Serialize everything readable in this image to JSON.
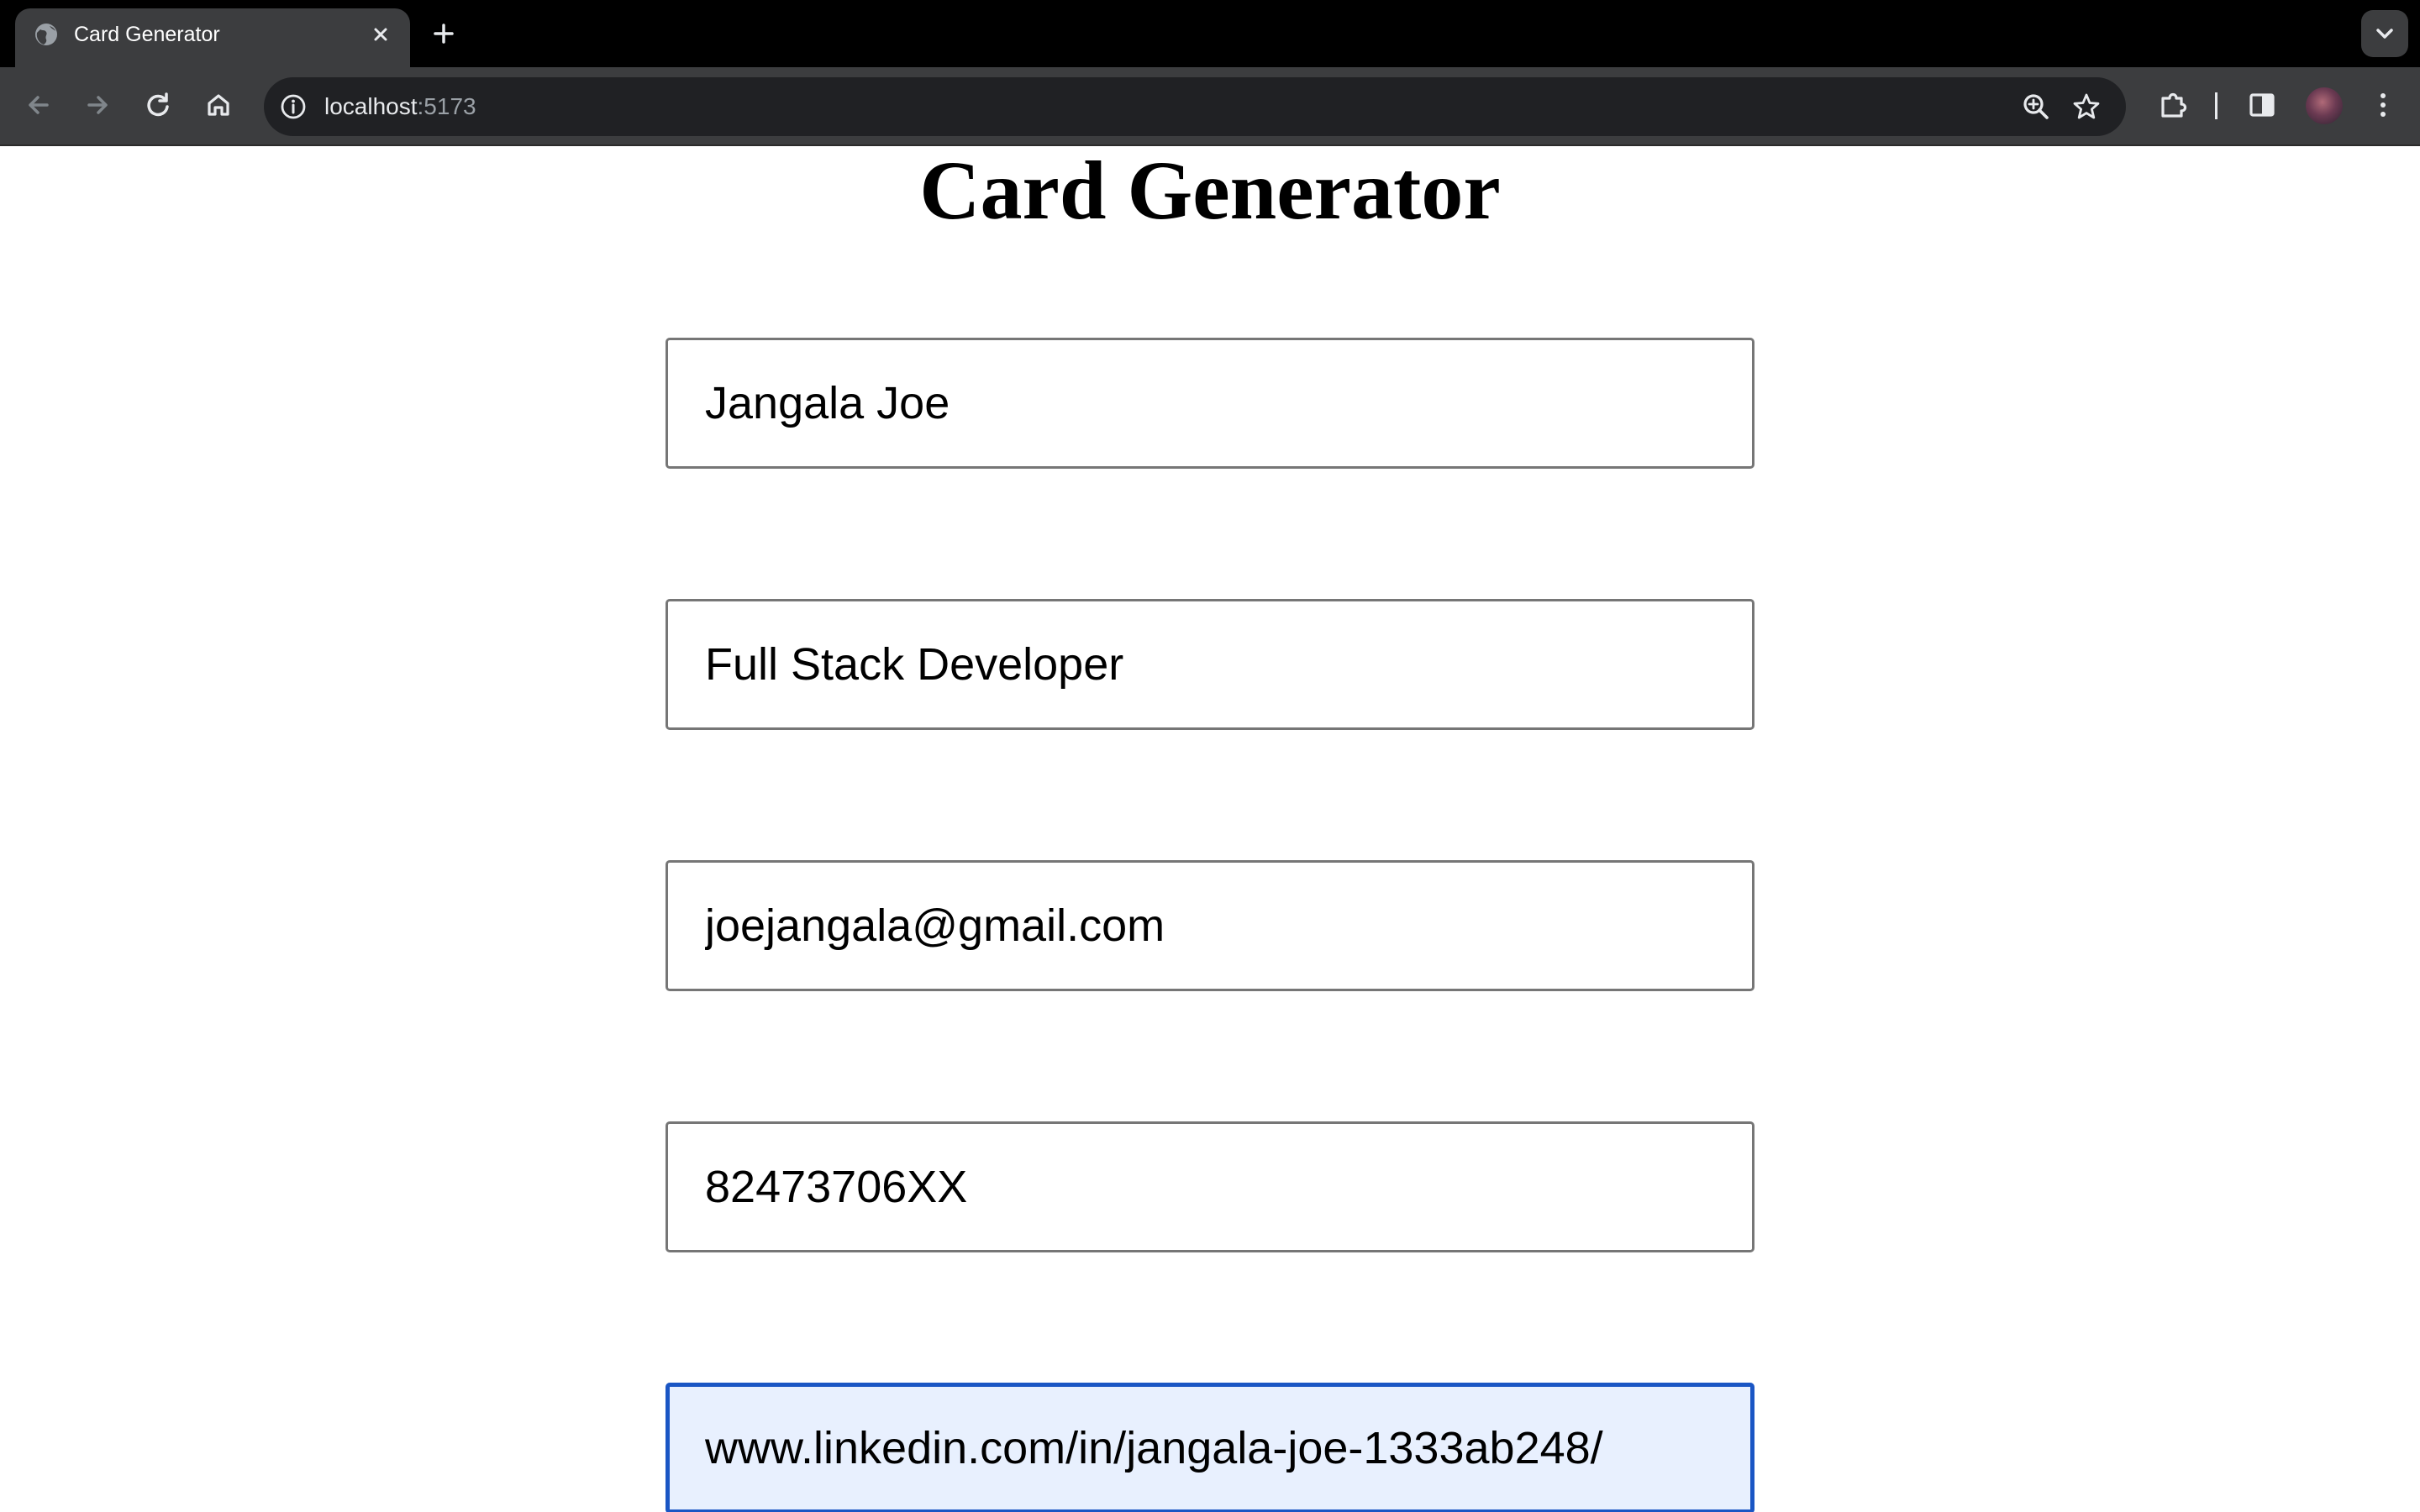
{
  "browser": {
    "tab": {
      "title": "Card Generator",
      "favicon": "globe-icon",
      "close_icon": "close-icon"
    },
    "new_tab_icon": "plus-icon",
    "tab_search_icon": "chevron-down-icon",
    "toolbar": {
      "back_icon": "back-arrow-icon",
      "forward_icon": "forward-arrow-icon",
      "reload_icon": "reload-icon",
      "home_icon": "home-icon",
      "extensions_icon": "puzzle-icon",
      "side_panel_icon": "side-panel-icon",
      "menu_icon": "kebab-menu-icon"
    },
    "omnibox": {
      "host": "localhost",
      "port": ":5173",
      "info_icon": "info-icon",
      "zoom_icon": "zoom-icon",
      "bookmark_icon": "star-icon"
    }
  },
  "page": {
    "title": "Card Generator",
    "fields": [
      {
        "name": "name-input",
        "value": "Jangala Joe"
      },
      {
        "name": "job-title-input",
        "value": "Full Stack Developer"
      },
      {
        "name": "email-input",
        "value": "joejangala@gmail.com"
      },
      {
        "name": "phone-input",
        "value": "82473706XX"
      },
      {
        "name": "linkedin-input",
        "value": "www.linkedin.com/in/jangala-joe-1333ab248/",
        "focused": true
      }
    ]
  },
  "colors": {
    "focus_border": "#1a56c4",
    "focus_background": "#e8f0fe",
    "field_border": "#767676",
    "toolbar": "#3c3d3f",
    "tabstrip": "#000000"
  }
}
